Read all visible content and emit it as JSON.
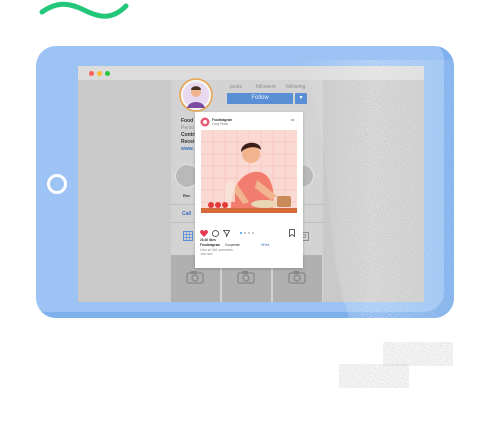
{
  "profile": {
    "stats": [
      "posts",
      "followers",
      "following"
    ],
    "follow_label": "Follow",
    "follow_dropdown": "▾",
    "name_lines": [
      "Food",
      "Perso",
      "Contri",
      "Recei",
      "www."
    ],
    "message_label": "Call",
    "highlight_labels": [
      "Rec",
      "",
      "",
      "Ideas"
    ]
  },
  "post": {
    "username": "Foodstagram",
    "sub": "Cozy Place",
    "more_icon": "•••",
    "likes": "20.46 likes",
    "caption_user": "Foodstagram",
    "caption_text": "Cooperate",
    "tag": "#Pork",
    "comments_line1": "View all 346 comments",
    "comments_line2": "Just now"
  },
  "colors": {
    "tablet": "#9cc3f3",
    "accent_green": "#22c77a",
    "heart": "#e63950",
    "follow": "#5a8fd6"
  }
}
